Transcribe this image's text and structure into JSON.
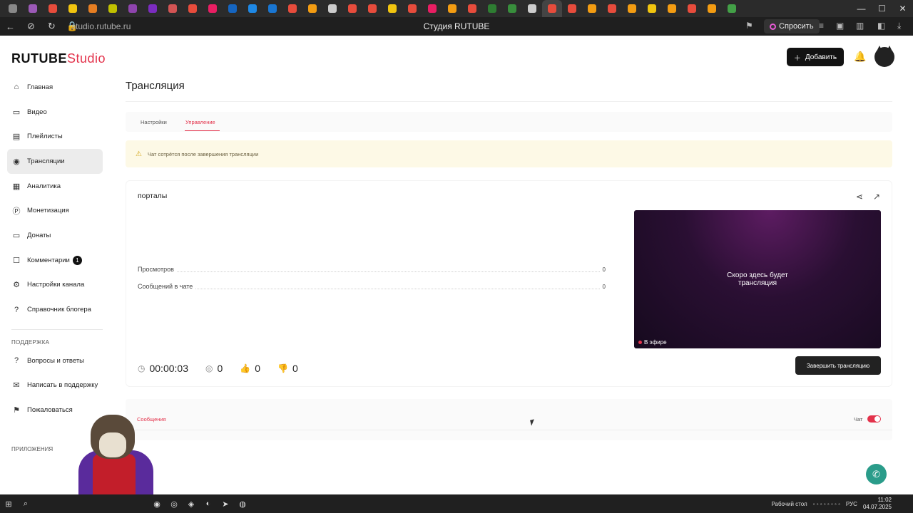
{
  "browser": {
    "url": "studio.rutube.ru",
    "title": "Студия RUTUBE",
    "ask_label": "Спросить",
    "tab_colors": [
      "#888888",
      "#9b59b6",
      "#e74c3c",
      "#f1c40f",
      "#e67e22",
      "#c0c000",
      "#8e44ad",
      "#7b2cbf",
      "#d35454",
      "#e74c3c",
      "#e91e63",
      "#1565c0",
      "#1e88e5",
      "#1976d2",
      "#e74c3c",
      "#f39c12",
      "#cccccc",
      "#e74c3c",
      "#e74c3c",
      "#f1c40f",
      "#e74c3c",
      "#e91e63",
      "#f39c12",
      "#e74c3c",
      "#2e7d32",
      "#388e3c",
      "#cccccc",
      "#e74c3c",
      "#e74c3c",
      "#f39c12",
      "#e74c3c",
      "#f39c12",
      "#f1c40f",
      "#f39c12",
      "#e74c3c",
      "#f39c12",
      "#43a047"
    ]
  },
  "header": {
    "logo_brand": "RUTUBE",
    "logo_studio": "Studio",
    "add_label": "Добавить"
  },
  "sidebar": {
    "items": [
      {
        "label": "Главная",
        "icon": "home-icon",
        "glyph": "⌂"
      },
      {
        "label": "Видео",
        "icon": "video-icon",
        "glyph": "▭"
      },
      {
        "label": "Плейлисты",
        "icon": "playlist-icon",
        "glyph": "▤"
      },
      {
        "label": "Трансляции",
        "icon": "broadcast-icon",
        "glyph": "◉",
        "active": true
      },
      {
        "label": "Аналитика",
        "icon": "analytics-icon",
        "glyph": "▦"
      },
      {
        "label": "Монетизация",
        "icon": "money-icon",
        "glyph": "Ⓟ"
      },
      {
        "label": "Донаты",
        "icon": "donate-icon",
        "glyph": "▭"
      },
      {
        "label": "Комментарии",
        "icon": "comment-icon",
        "glyph": "☐",
        "badge": "1"
      },
      {
        "label": "Настройки канала",
        "icon": "settings-icon",
        "glyph": "⚙"
      },
      {
        "label": "Справочник блогера",
        "icon": "help-icon",
        "glyph": "?"
      }
    ],
    "support_title": "ПОДДЕРЖКА",
    "support_items": [
      {
        "label": "Вопросы и ответы",
        "icon": "faq-icon",
        "glyph": "?"
      },
      {
        "label": "Написать в поддержку",
        "icon": "mail-icon",
        "glyph": "✉"
      },
      {
        "label": "Пожаловаться",
        "icon": "flag-icon",
        "glyph": "⚑"
      }
    ],
    "apps_title": "ПРИЛОЖЕНИЯ"
  },
  "main": {
    "title": "Трансляция",
    "tabs": [
      "Настройки",
      "Управление"
    ],
    "alert": "Чат сотрётся после завершения трансляции",
    "stream_title": "порталы",
    "stats": [
      {
        "label": "Просмотров",
        "value": "0"
      },
      {
        "label": "Сообщений в чате",
        "value": "0"
      }
    ],
    "preview_text_1": "Скоро здесь будет",
    "preview_text_2": "трансляция",
    "on_air": "В эфире",
    "end_button": "Завершить трансляцию",
    "timer": "00:00:03",
    "viewers": "0",
    "likes": "0",
    "dislikes": "0",
    "chat_tab": "Сообщения",
    "chat_label": "Чат"
  },
  "taskbar": {
    "desktop_label": "Рабочий стол",
    "lang": "РУС",
    "time": "11:02",
    "date": "04.07.2025"
  }
}
